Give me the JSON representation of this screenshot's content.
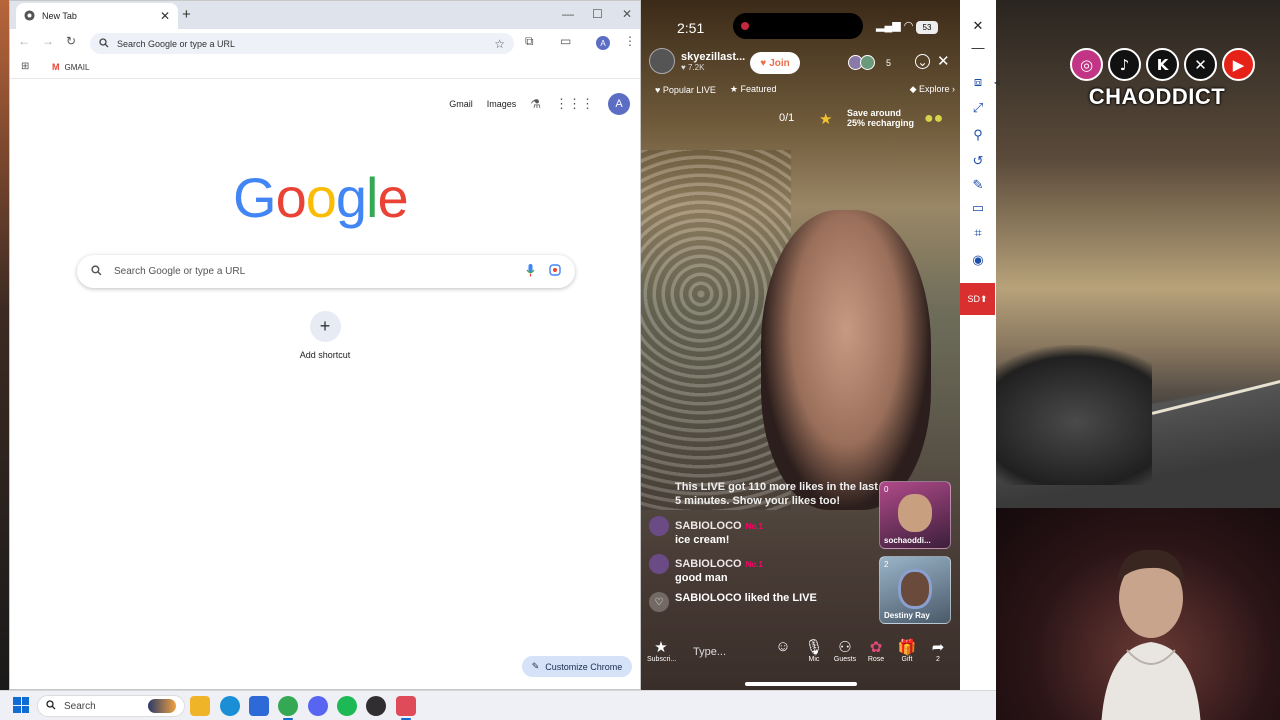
{
  "social": {
    "icons": [
      "instagram-icon",
      "tiktok-icon",
      "kick-icon",
      "x-icon",
      "youtube-icon"
    ],
    "glyphs": [
      "◎",
      "♪",
      "K",
      "✕",
      "▶"
    ],
    "colors": [
      "#c13584",
      "#111111",
      "#111111",
      "#111111",
      "#e62117"
    ],
    "brand": "CHAODDICT"
  },
  "chrome": {
    "tab_title": "New Tab",
    "tab_close": "✕",
    "new_tab": "+",
    "omnibox_placeholder": "Search Google or type a URL",
    "bookmark": "GMAIL",
    "profile_initial": "A",
    "top_links": [
      "Gmail",
      "Images"
    ],
    "logo_letters": [
      "G",
      "o",
      "o",
      "g",
      "l",
      "e"
    ],
    "logo_colors": [
      "#4285f4",
      "#ea4335",
      "#fbbc05",
      "#4285f4",
      "#34a853",
      "#ea4335"
    ],
    "search_placeholder": "Search Google or type a URL",
    "shortcut_label": "Add shortcut",
    "customize_label": "Customize Chrome"
  },
  "phone": {
    "time": "2:51",
    "battery": "53",
    "host_name": "skyezillast...",
    "host_likes": "♥ 7.2K",
    "join_label": "Join",
    "viewer_count": "5",
    "tabs": [
      "Popular LIVE",
      "Featured",
      "Explore"
    ],
    "counter": "0/1",
    "save_line1": "Save around",
    "save_line2": "25% recharging",
    "notice": "This LIVE got 110 more likes in the last 5 minutes. Show your likes too!",
    "messages": [
      {
        "user": "SABIOLOCO",
        "badge": "No.1",
        "text": "ice cream!"
      },
      {
        "user": "SABIOLOCO",
        "badge": "No.1",
        "text": "good man"
      }
    ],
    "liked": "SABIOLOCO liked the LIVE",
    "guests": [
      {
        "count": "0",
        "name": "sochaoddi..."
      },
      {
        "count": "2",
        "name": "Destiny Ray"
      }
    ],
    "type_placeholder": "Type...",
    "bottom_labels": [
      "Subscri...",
      "Mic",
      "Guests",
      "Rose",
      "Gift",
      "2"
    ]
  },
  "snip": {
    "sd_label": "SD"
  },
  "taskbar": {
    "search_label": "Search",
    "apps": [
      "file-explorer",
      "edge",
      "store",
      "chrome",
      "discord",
      "spotify",
      "obs",
      "snipping-tool"
    ],
    "app_colors": [
      "#f0b429",
      "#1a8fd6",
      "#2d6ad8",
      "#34a853",
      "#5865f2",
      "#1db954",
      "#302e31",
      "#e04b5a"
    ]
  }
}
